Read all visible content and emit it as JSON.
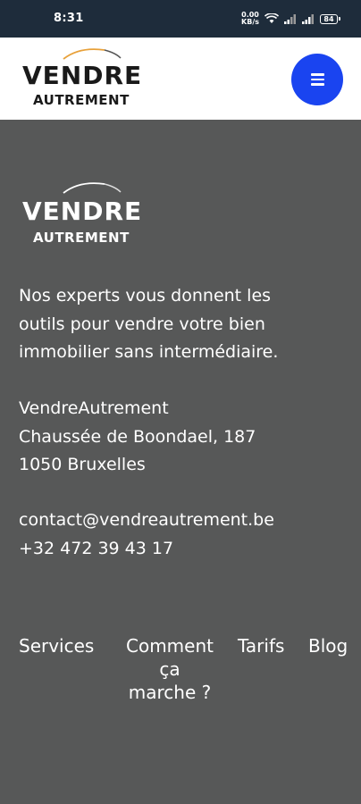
{
  "status_bar": {
    "time": "8:31",
    "data_speed_top": "0.00",
    "data_speed_bottom": "KB/s",
    "battery": "84",
    "icons": [
      "wifi-icon",
      "signal-icon",
      "signal-icon",
      "battery-icon"
    ]
  },
  "header": {
    "logo_line1": "VENDRE",
    "logo_line2": "AUTREMENT",
    "logo_arc_color": "#e8a13a",
    "menu_button_color": "#1a44f0"
  },
  "footer": {
    "logo_line1": "VENDRE",
    "logo_line2": "AUTREMENT",
    "description": [
      "Nos experts vous donnent les",
      "outils pour vendre votre bien",
      "immobilier sans intermédiaire."
    ],
    "address": [
      "VendreAutrement",
      "Chaussée de Boondael, 187",
      "1050 Bruxelles"
    ],
    "email": "contact@vendreautrement.be",
    "phone": "+32 472 39 43 17",
    "nav": {
      "services": "Services",
      "comment_line1": "Comment",
      "comment_line2": "ça",
      "comment_line3": "marche ?",
      "tarifs": "Tarifs",
      "blog": "Blog"
    }
  },
  "colors": {
    "status_bar": "#1e2c3b",
    "header_bg": "#ffffff",
    "footer_bg": "#575858"
  }
}
